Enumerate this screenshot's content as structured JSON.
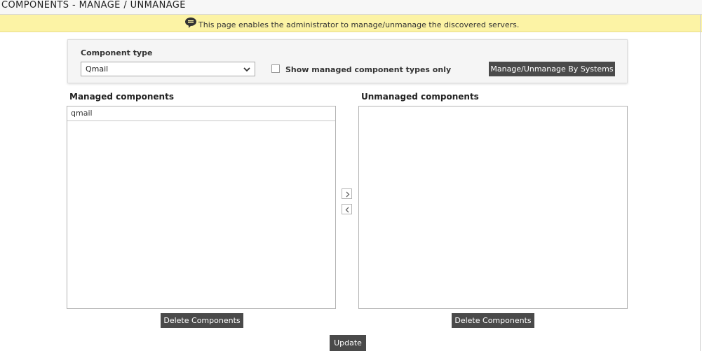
{
  "page": {
    "title": "COMPONENTS - MANAGE / UNMANAGE",
    "info": "This page enables the administrator to manage/unmanage the discovered servers."
  },
  "filter": {
    "component_type_label": "Component type",
    "component_type_value": "Qmail",
    "show_managed_label": "Show managed component types only",
    "show_managed_checked": false,
    "by_systems_button": "Manage/Unmanage By Systems"
  },
  "managed": {
    "heading": "Managed components",
    "items": [
      "qmail"
    ],
    "delete_button": "Delete Components"
  },
  "unmanaged": {
    "heading": "Unmanaged components",
    "items": [],
    "delete_button": "Delete Components"
  },
  "actions": {
    "update_button": "Update"
  },
  "icons": {
    "info": "comment-info-icon",
    "dropdown": "chevron-down-icon",
    "move_right": "chevron-right-icon",
    "move_left": "chevron-left-icon"
  },
  "colors": {
    "banner": "#fcf3a5",
    "button": "#4a4a4a"
  }
}
